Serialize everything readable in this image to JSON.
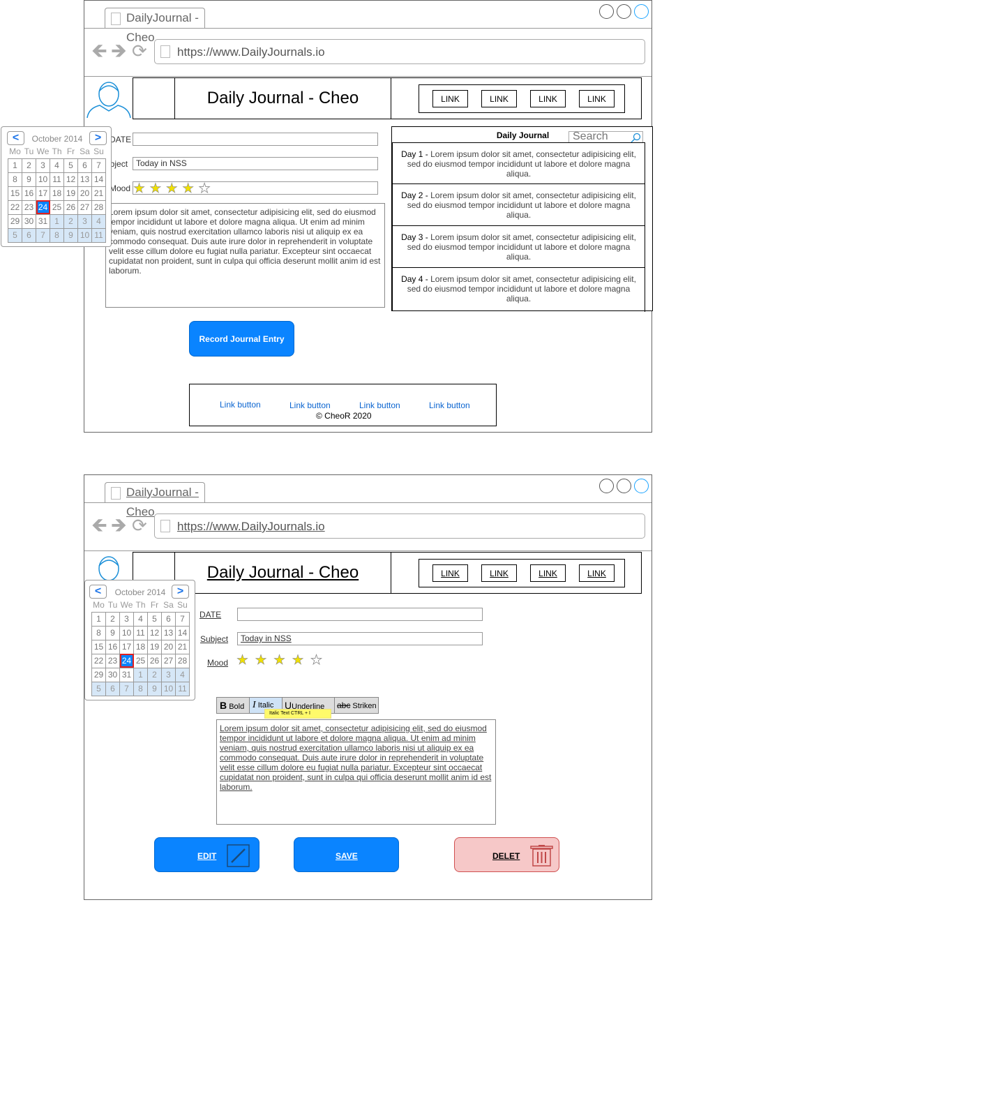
{
  "browser": {
    "tab_title": "DailyJournal - Cheo",
    "url": "https://www.DailyJournals.io"
  },
  "header": {
    "title": "Daily Journal - Cheo",
    "links": [
      "LINK",
      "LINK",
      "LINK",
      "LINK"
    ]
  },
  "form": {
    "date_label": "DATE",
    "date_value": "",
    "subject_label": "Subject",
    "subject_value": "Today in NSS",
    "mood_label": "Mood",
    "mood_rating": 4,
    "mood_max": 5,
    "body": "Lorem ipsum dolor sit amet, consectetur adipisicing elit, sed do eiusmod tempor incididunt ut labore et dolore magna aliqua. Ut enim ad minim veniam, quis nostrud exercitation ullamco laboris nisi ut aliquip ex ea commodo consequat. Duis aute irure dolor in reprehenderit in voluptate velit esse cillum dolore eu fugiat nulla pariatur. Excepteur sint occaecat cupidatat non proident, sunt in culpa qui officia deserunt mollit anim id est laborum."
  },
  "calendar": {
    "month": "October 2014",
    "prev": "<",
    "next": ">",
    "weekdays": [
      "Mo",
      "Tu",
      "We",
      "Th",
      "Fr",
      "Sa",
      "Su"
    ],
    "weeks": [
      [
        "1",
        "2",
        "3",
        "4",
        "5",
        "6",
        "7"
      ],
      [
        "8",
        "9",
        "10",
        "11",
        "12",
        "13",
        "14"
      ],
      [
        "15",
        "16",
        "17",
        "18",
        "19",
        "20",
        "21"
      ],
      [
        "22",
        "23",
        "24",
        "25",
        "26",
        "27",
        "28"
      ],
      [
        "29",
        "30",
        "31",
        "1",
        "2",
        "3",
        "4"
      ],
      [
        "5",
        "6",
        "7",
        "8",
        "9",
        "10",
        "11"
      ]
    ],
    "selected": "24"
  },
  "journal_list": {
    "title": "Daily Journal",
    "search_placeholder": "Search",
    "entries": [
      {
        "day": "Day 1 -",
        "text": "Lorem ipsum dolor sit amet, consectetur adipisicing elit, sed do eiusmod tempor incididunt ut labore et dolore magna aliqua."
      },
      {
        "day": "Day 2 -",
        "text": "Lorem ipsum dolor sit amet, consectetur adipisicing elit, sed do eiusmod tempor incididunt ut labore et dolore magna aliqua."
      },
      {
        "day": "Day 3 -",
        "text": "Lorem ipsum dolor sit amet, consectetur adipisicing elit, sed do eiusmod tempor incididunt ut labore et dolore magna aliqua."
      },
      {
        "day": "Day 4 -",
        "text": "Lorem ipsum dolor sit amet, consectetur adipisicing elit, sed do eiusmod tempor incididunt ut labore et dolore magna aliqua."
      }
    ]
  },
  "record_button": "Record Journal Entry",
  "footer": {
    "links": [
      "Link button",
      "Link button",
      "Link button",
      "Link button"
    ],
    "copyright": "© CheoR 2020"
  },
  "editor": {
    "bold": "Bold",
    "bold_glyph": "B",
    "italic": "Italic",
    "italic_glyph": "I",
    "underline": "Underline",
    "underline_glyph": "U",
    "strike": "Striken",
    "strike_glyph": "abc",
    "tooltip": "Italic Text CTRL + I"
  },
  "actions": {
    "edit": "EDIT",
    "save": "SAVE",
    "delete": "DELET"
  },
  "colors": {
    "accent": "#0a84ff",
    "delete_bg": "#f6c8c8",
    "selected_outline": "#e02020"
  }
}
